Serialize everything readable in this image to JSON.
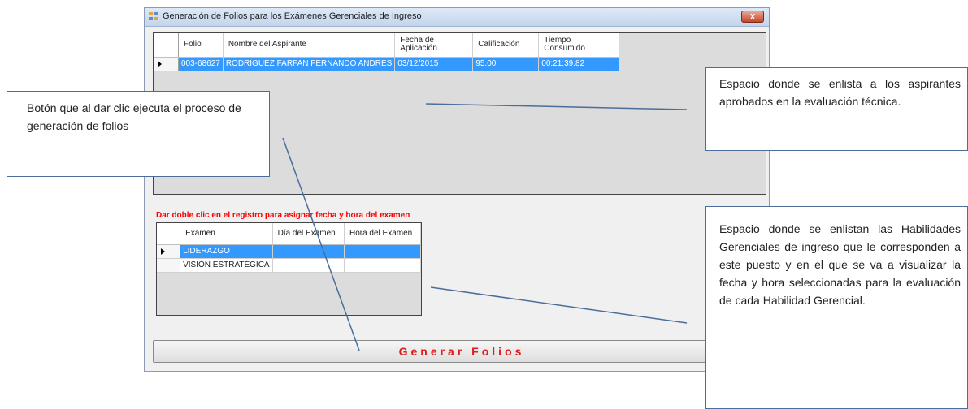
{
  "window": {
    "title": "Generación de Folios para los Exámenes Gerenciales de Ingreso",
    "close_label": "X"
  },
  "grid_aspirants": {
    "columns": [
      "Folio",
      "Nombre del Aspirante",
      "Fecha de Aplicación",
      "Calificación",
      "Tiempo Consumido"
    ],
    "rows": [
      {
        "folio": "003-68627",
        "nombre": "RODRIGUEZ FARFAN FERNANDO ANDRES",
        "fecha": "03/12/2015",
        "calificacion": "95.00",
        "tiempo": "00:21:39.82"
      }
    ]
  },
  "instruction": "Dar doble clic en el registro para asignar fecha y hora del examen",
  "grid_exams": {
    "columns": [
      "Examen",
      "Día del Examen",
      "Hora del Examen"
    ],
    "rows": [
      {
        "examen": "LIDERAZGO",
        "dia": "",
        "hora": ""
      },
      {
        "examen": "VISIÓN ESTRATÉGICA",
        "dia": "",
        "hora": ""
      }
    ]
  },
  "generate_button": "Generar Folios",
  "callouts": {
    "button": "Botón que al dar clic ejecuta el proceso de generación de folios",
    "aspirants": "Espacio donde se enlista a los aspirantes aprobados en la evaluación técnica.",
    "skills": "Espacio donde se enlistan las Habilidades Gerenciales de ingreso que le corresponden a este puesto y en el que se va a visualizar la fecha y hora seleccionadas para la evaluación de cada Habilidad Gerencial."
  }
}
